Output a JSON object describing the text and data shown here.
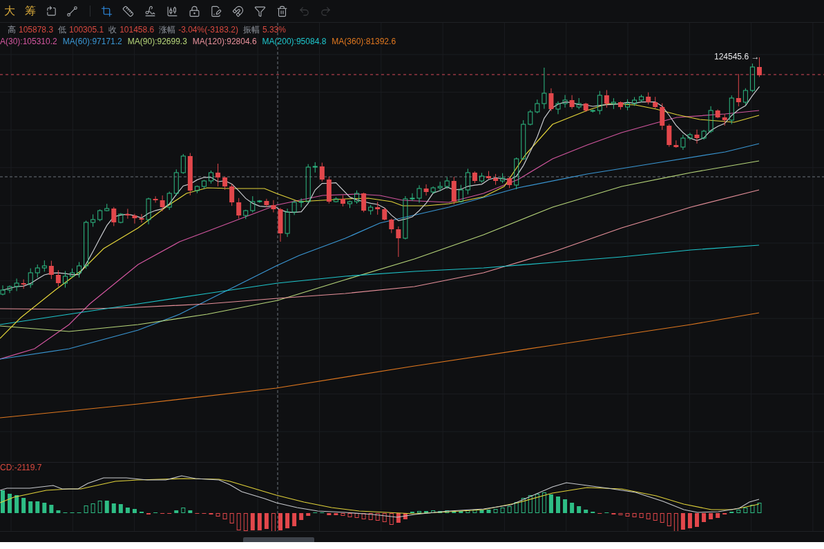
{
  "toolbar": {
    "text_buttons": [
      {
        "label": "大"
      },
      {
        "label": "筹"
      }
    ],
    "view_tools": [
      {
        "kind": "rotate-square",
        "selected": false,
        "disabled": false
      },
      {
        "kind": "line",
        "selected": false,
        "disabled": false
      }
    ],
    "drawing_tools": [
      {
        "kind": "crop",
        "selected": true,
        "disabled": false
      },
      {
        "kind": "ruler",
        "selected": false,
        "disabled": false
      },
      {
        "kind": "signature",
        "selected": false,
        "disabled": false
      },
      {
        "kind": "candles",
        "selected": false,
        "disabled": false
      },
      {
        "kind": "lock",
        "selected": false,
        "disabled": false
      },
      {
        "kind": "note",
        "selected": false,
        "disabled": false
      },
      {
        "kind": "magnet",
        "selected": false,
        "disabled": false
      },
      {
        "kind": "filter",
        "selected": false,
        "disabled": false
      },
      {
        "kind": "trash",
        "selected": false,
        "disabled": false
      },
      {
        "kind": "undo",
        "selected": false,
        "disabled": true
      },
      {
        "kind": "redo",
        "selected": false,
        "disabled": true
      }
    ]
  },
  "price_info": {
    "falling": true,
    "items": [
      {
        "label": "高",
        "value": "105878.3"
      },
      {
        "label": "低",
        "value": "100305.1"
      },
      {
        "label": "收",
        "value": "101458.6"
      },
      {
        "label": "涨幅",
        "value": "-3.04%(-3183.2)"
      },
      {
        "label": "振幅",
        "value": "5.33%"
      }
    ]
  },
  "ma_legend": [
    {
      "text": "A(30):105310.2",
      "color": "#d2569f"
    },
    {
      "text": "MA(60):97171.2",
      "color": "#3a97d4"
    },
    {
      "text": "MA(90):92699.3",
      "color": "#b7d67a"
    },
    {
      "text": "MA(120):92804.6",
      "color": "#e8919b"
    },
    {
      "text": "MA(200):95084.8",
      "color": "#1ec6cc"
    },
    {
      "text": "MA(360):81392.6",
      "color": "#e0781f"
    }
  ],
  "price_chart": {
    "max_price_label": "124545.6 →"
  },
  "macd": {
    "label": "CD:-2119.7"
  }
}
